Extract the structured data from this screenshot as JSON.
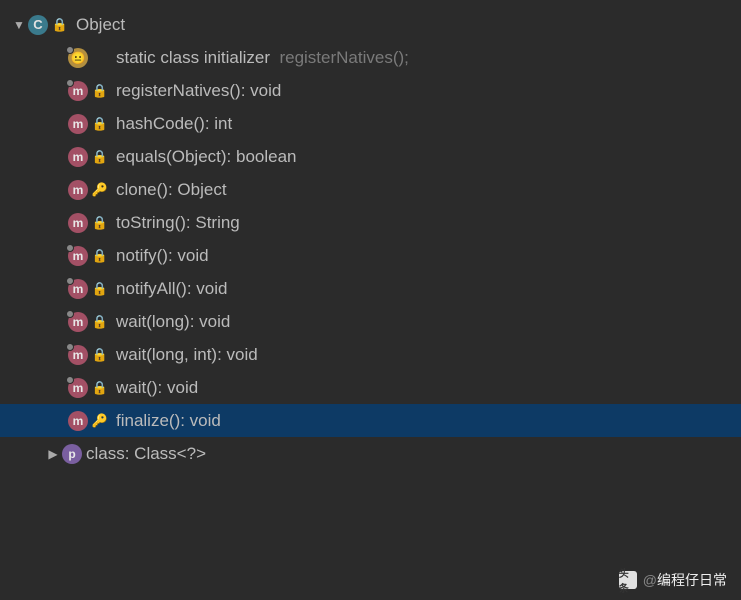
{
  "root": {
    "name": "Object",
    "expanded": true
  },
  "members": [
    {
      "kind": "init",
      "overlay": true,
      "modifier": "",
      "label": "static class initializer",
      "dim": "registerNatives();",
      "selected": false
    },
    {
      "kind": "method",
      "overlay": true,
      "modifier": "private",
      "label": "registerNatives(): void",
      "dim": "",
      "selected": false
    },
    {
      "kind": "method",
      "overlay": false,
      "modifier": "lock",
      "label": "hashCode(): int",
      "dim": "",
      "selected": false
    },
    {
      "kind": "method",
      "overlay": false,
      "modifier": "lock",
      "label": "equals(Object): boolean",
      "dim": "",
      "selected": false
    },
    {
      "kind": "method",
      "overlay": false,
      "modifier": "key",
      "label": "clone(): Object",
      "dim": "",
      "selected": false
    },
    {
      "kind": "method",
      "overlay": false,
      "modifier": "lock",
      "label": "toString(): String",
      "dim": "",
      "selected": false
    },
    {
      "kind": "method",
      "overlay": true,
      "modifier": "lock",
      "label": "notify(): void",
      "dim": "",
      "selected": false
    },
    {
      "kind": "method",
      "overlay": true,
      "modifier": "lock",
      "label": "notifyAll(): void",
      "dim": "",
      "selected": false
    },
    {
      "kind": "method",
      "overlay": true,
      "modifier": "lock",
      "label": "wait(long): void",
      "dim": "",
      "selected": false
    },
    {
      "kind": "method",
      "overlay": true,
      "modifier": "lock",
      "label": "wait(long, int): void",
      "dim": "",
      "selected": false
    },
    {
      "kind": "method",
      "overlay": true,
      "modifier": "lock",
      "label": "wait(): void",
      "dim": "",
      "selected": false
    },
    {
      "kind": "method",
      "overlay": false,
      "modifier": "key",
      "label": "finalize(): void",
      "dim": "",
      "selected": true
    }
  ],
  "sub": {
    "kind": "property",
    "label": "class: Class<?>",
    "expanded": false
  },
  "watermark": {
    "logo": "头条",
    "at": "@",
    "name": "编程仔日常"
  },
  "glyphs": {
    "arrow_down": "▼",
    "arrow_right": "▶",
    "lock": "🔒",
    "private_lock": "🔒",
    "key": "🔑",
    "class_letter": "C",
    "method_letter": "m",
    "property_letter": "p",
    "init_face": "😐"
  }
}
